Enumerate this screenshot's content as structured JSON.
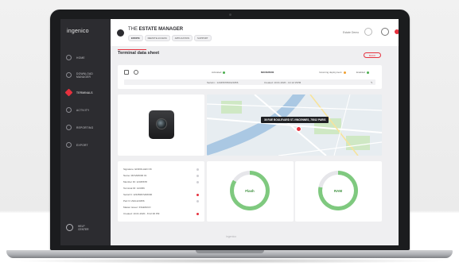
{
  "brand": {
    "name": "ingenico"
  },
  "sidebar": {
    "items": [
      {
        "label": "HOME",
        "icon": "home-icon"
      },
      {
        "label": "DOWNLOAD MANAGER",
        "icon": "download-icon"
      },
      {
        "label": "TERMINALS",
        "icon": "terminal-icon",
        "active": true
      },
      {
        "label": "ACTIVITY",
        "icon": "activity-icon"
      },
      {
        "label": "REPORTING",
        "icon": "reporting-icon"
      },
      {
        "label": "EXPORT",
        "icon": "export-icon"
      }
    ],
    "help_label": "HELP CENTER"
  },
  "header": {
    "title_prefix": "THE",
    "title_main": "ESTATE MANAGER",
    "pills": [
      "ESTATE",
      "REMOTE ACCESS",
      "APPLICATION",
      "SUPPORT"
    ],
    "user_name": "Estate Demo",
    "notif_color": "#e6313e"
  },
  "page": {
    "title": "Terminal data sheet",
    "back_label": "BACK"
  },
  "infobar": {
    "status_text": "Activated",
    "terminal_name": "MOVE/5000",
    "monitoring_text": "Incoming deployment",
    "network_text": "Enabled",
    "row2_serial": "Serial n.: 1234567890123456",
    "row2_date": "Created: 10.01.2020 - 14:12:15PM",
    "accent": "#e6313e",
    "ok_color": "#4caf50"
  },
  "map": {
    "address": "36 RUE BOULEVARD ST-VINCENNES, 75012 PARIS"
  },
  "details": [
    "Signature: ENROLLED OK",
    "Name: MOVE5000 01",
    "Member ID: 12345678",
    "Terminal ID: 123456",
    "Serial N: 12345MOVE5000",
    "Part N: ZHG123456",
    "Master issuer: INGENICO",
    "Created: 10.01.2020 - 8:12:30 PM"
  ],
  "gauges": [
    {
      "label": "Flash",
      "percent": 84,
      "color": "#7fc97f"
    },
    {
      "label": "RAM",
      "percent": 78,
      "color": "#7fc97f"
    }
  ],
  "footer": {
    "logo": "ingenico"
  }
}
